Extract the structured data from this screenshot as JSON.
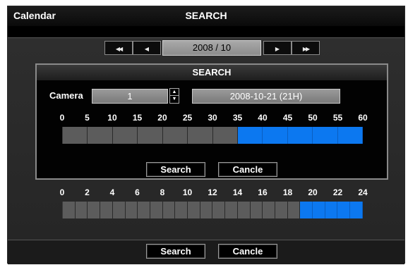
{
  "window": {
    "app_title": "Calendar",
    "screen_title": "SEARCH"
  },
  "nav": {
    "first_glyph": "◀◀",
    "prev_glyph": "◀",
    "next_glyph": "▶",
    "last_glyph": "▶▶",
    "month_value": "2008 / 10"
  },
  "dialog": {
    "title": "SEARCH",
    "camera_label": "Camera",
    "camera_value": "1",
    "datetime_value": "2008-10-21 (21H)",
    "minute_ticks": [
      "0",
      "5",
      "10",
      "15",
      "20",
      "25",
      "30",
      "35",
      "40",
      "45",
      "50",
      "55",
      "60"
    ],
    "minute_segments": 12,
    "minute_recorded_from_segment": 7,
    "search_label": "Search",
    "cancel_label": "Cancle"
  },
  "hours": {
    "ticks": [
      "0",
      "2",
      "4",
      "6",
      "8",
      "10",
      "12",
      "14",
      "16",
      "18",
      "20",
      "22",
      "24"
    ],
    "segments": 24,
    "recorded_from_hour": 19
  },
  "footer": {
    "search_label": "Search",
    "cancel_label": "Cancle"
  },
  "colors": {
    "recorded": "#0c78f0",
    "empty": "#5c5c5c"
  }
}
